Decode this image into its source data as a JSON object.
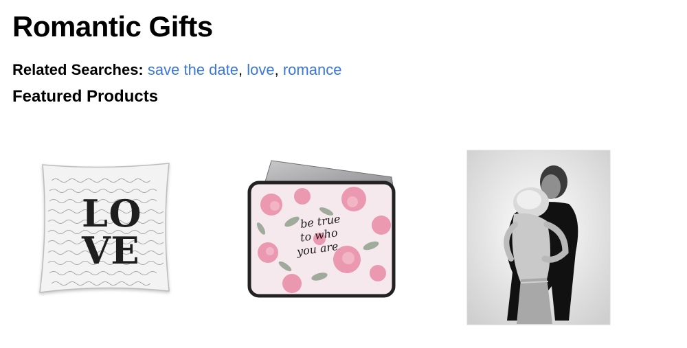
{
  "page": {
    "title": "Romantic Gifts"
  },
  "related_searches": {
    "label": "Related Searches:",
    "links": [
      "save the date",
      "love",
      "romance"
    ],
    "separator": ","
  },
  "featured": {
    "heading": "Featured Products",
    "products": [
      {
        "name": "love-script-pillow",
        "art_text": "LOVE"
      },
      {
        "name": "floral-laptop-sleeve",
        "art_text": "be true to who you are"
      },
      {
        "name": "black-and-white-embracing-couple-print"
      }
    ]
  },
  "colors": {
    "link": "#3a78d8",
    "text": "#000000",
    "background": "#ffffff",
    "floral_pink": "#e98aa6"
  }
}
